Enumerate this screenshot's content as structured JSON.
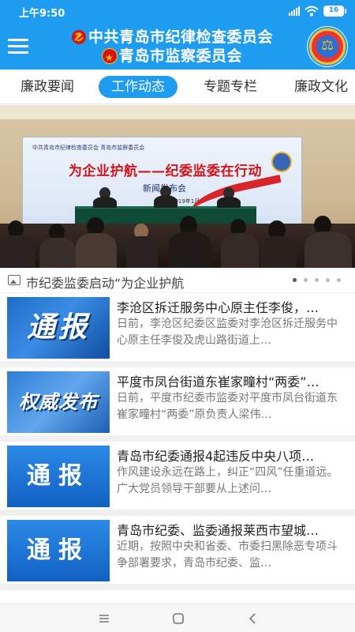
{
  "status_bar": {
    "time": "上午9:50",
    "battery": "16"
  },
  "header": {
    "title_line1": "中共青岛市纪律检查委员会",
    "title_line2": "青岛市监察委员会",
    "brand_color": "#1e9cf0"
  },
  "tabs": [
    {
      "label": "廉政要闻",
      "active": false
    },
    {
      "label": "工作动态",
      "active": true
    },
    {
      "label": "专题专栏",
      "active": false
    },
    {
      "label": "廉政文化",
      "active": false
    }
  ],
  "banner": {
    "screen_org": "中共青岛市纪律检查委员会  青岛市监察委员会",
    "screen_slogan": "为企业护航——纪委监委在行动",
    "screen_sub": "新闻发布会",
    "screen_date": "2019年1月",
    "caption": "市纪委监委启动“为企业护航",
    "slides": 5,
    "active_slide": 1
  },
  "news": [
    {
      "thumb_text": "通报",
      "title": "李沧区拆迁服务中心原主任李俊，…",
      "summary": "日前，李沧区纪委区监委对李沧区拆迁服务中心原主任李俊及虎山路街道上…"
    },
    {
      "thumb_text": "权威发布",
      "title": "平度市凤台街道东崔家疃村“两委”…",
      "summary": "日前，平度市纪委市监委对平度市凤台街道东崔家疃村“两委”原负责人梁伟…"
    },
    {
      "thumb_text": "通报",
      "title": "青岛市纪委通报4起违反中央八项…",
      "summary": "作风建设永远在路上，纠正“四风”任重道远。广大党员领导干部要从上述问…"
    },
    {
      "thumb_text": "通报",
      "title": "青岛市纪委、监委通报莱西市望城…",
      "summary": "近期，按照中央和省委、市委扫黑除恶专项斗争部署要求，青岛市纪委、监…"
    }
  ],
  "icons": {
    "menu": "hamburger-menu-icon",
    "image": "image-icon",
    "nav_recent": "menu-lines-icon",
    "nav_home": "square-home-icon",
    "nav_back": "chevron-back-icon"
  }
}
